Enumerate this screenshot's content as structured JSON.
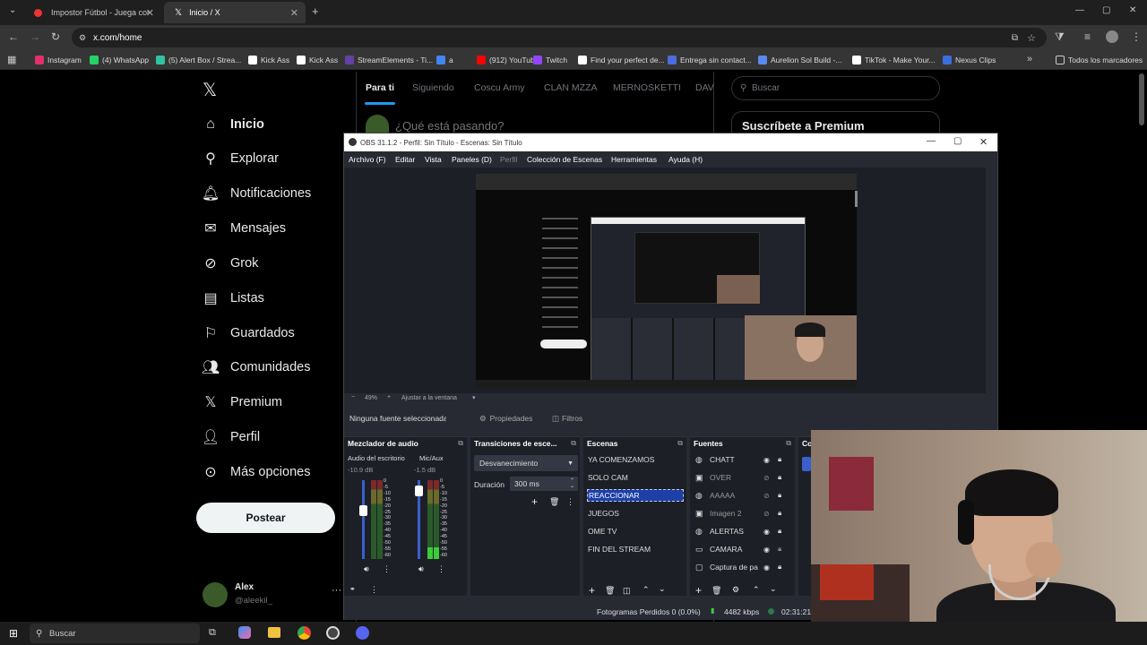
{
  "browser": {
    "tabs": [
      {
        "title": "Impostor Fútbol - Juega con ami"
      },
      {
        "title": "Inicio / X"
      }
    ],
    "url": "x.com/home",
    "bookmarks": [
      {
        "label": "Instagram",
        "color": "#e1306c"
      },
      {
        "label": "(4) WhatsApp",
        "color": "#25d366"
      },
      {
        "label": "(5) Alert Box / Strea...",
        "color": "#31c3a2"
      },
      {
        "label": "Kick Ass",
        "color": "#ffffff"
      },
      {
        "label": "Kick Ass",
        "color": "#ffffff"
      },
      {
        "label": "StreamElements - Ti...",
        "color": "#6441a5"
      },
      {
        "label": "a",
        "color": "#4285f4"
      },
      {
        "label": "(912) YouTube",
        "color": "#ff0000"
      },
      {
        "label": "Twitch",
        "color": "#9146ff"
      },
      {
        "label": "Find your perfect de...",
        "color": "#ffffff"
      },
      {
        "label": "Entrega sin contact...",
        "color": "#4a6ee0"
      },
      {
        "label": "Aurelion Sol Build -...",
        "color": "#5a8af0"
      },
      {
        "label": "TikTok - Make Your...",
        "color": "#ffffff"
      },
      {
        "label": "Nexus Clips",
        "color": "#3b6fe0"
      }
    ],
    "bookmarks_folder": "Todos los marcadores"
  },
  "x": {
    "nav": [
      {
        "label": "Inicio",
        "icon": "home-icon",
        "glyph": "⌂",
        "bold": true
      },
      {
        "label": "Explorar",
        "icon": "search-icon",
        "glyph": "⚲"
      },
      {
        "label": "Notificaciones",
        "icon": "bell-icon",
        "glyph": "🔔︎"
      },
      {
        "label": "Mensajes",
        "icon": "mail-icon",
        "glyph": "✉"
      },
      {
        "label": "Grok",
        "icon": "grok-icon",
        "glyph": "⊘"
      },
      {
        "label": "Listas",
        "icon": "list-icon",
        "glyph": "▤"
      },
      {
        "label": "Guardados",
        "icon": "bookmark-icon",
        "glyph": "⚐"
      },
      {
        "label": "Comunidades",
        "icon": "people-icon",
        "glyph": "👥︎"
      },
      {
        "label": "Premium",
        "icon": "x-logo-icon",
        "glyph": "𝕏"
      },
      {
        "label": "Perfil",
        "icon": "person-icon",
        "glyph": "👤︎"
      },
      {
        "label": "Más opciones",
        "icon": "more-circle-icon",
        "glyph": "⊙"
      }
    ],
    "post_button": "Postear",
    "user": {
      "name": "Alex",
      "handle": "@aleekil_"
    },
    "feed_tabs": [
      "Para ti",
      "Siguiendo",
      "Coscu Army",
      "CLAN MZZA",
      "MERNOSKETTI",
      "DAV"
    ],
    "compose_placeholder": "¿Qué está pasando?",
    "search_placeholder": "Buscar",
    "premium_title": "Suscríbete a Premium"
  },
  "obs": {
    "title": "OBS 31.1.2 - Perfil: Sin Título - Escenas: Sin Título",
    "menu": [
      "Archivo (F)",
      "Editar",
      "Vista",
      "Paneles (D)",
      "Perfil",
      "Colección de Escenas",
      "Herramientas",
      "Ayuda (H)"
    ],
    "zoom": "49%",
    "fit_label": "Ajustar a la ventana",
    "no_source": "Ninguna fuente seleccionada",
    "properties": "Propiedades",
    "filters": "Filtros",
    "mixer": {
      "title": "Mezclador de audio",
      "ch1": "Audio del escritorio",
      "ch1_db": "-10.9 dB",
      "ch2": "Mic/Aux",
      "ch2_db": "-1.5 dB",
      "scale": [
        "0",
        "-5",
        "-10",
        "-15",
        "-20",
        "-25",
        "-30",
        "-35",
        "-40",
        "-45",
        "-50",
        "-55",
        "-60"
      ]
    },
    "transitions": {
      "title": "Transiciones de esce...",
      "type": "Desvanecimiento",
      "duration_label": "Duración",
      "duration": "300 ms"
    },
    "scenes": {
      "title": "Escenas",
      "items": [
        "YA COMENZAMOS",
        "SOLO CAM",
        "REACCIONAR",
        "JUEGOS",
        "OME TV",
        "FIN DEL STREAM"
      ],
      "selected": "REACCIONAR"
    },
    "sources": {
      "title": "Fuentes",
      "items": [
        {
          "name": "CHATT",
          "icon": "browser-source-icon",
          "glyph": "◍",
          "visible": true,
          "locked": true
        },
        {
          "name": "OVER",
          "icon": "image-source-icon",
          "glyph": "▣",
          "visible": false,
          "locked": true
        },
        {
          "name": "AAAAA",
          "icon": "browser-source-icon",
          "glyph": "◍",
          "visible": false,
          "locked": true
        },
        {
          "name": "Imagen 2",
          "icon": "image-source-icon",
          "glyph": "▣",
          "visible": false,
          "locked": true
        },
        {
          "name": "ALERTAS",
          "icon": "browser-source-icon",
          "glyph": "◍",
          "visible": true,
          "locked": true
        },
        {
          "name": "CAMARA",
          "icon": "camera-source-icon",
          "glyph": "▭",
          "visible": true,
          "locked": false
        },
        {
          "name": "Captura de pa",
          "icon": "display-source-icon",
          "glyph": "▢",
          "visible": true,
          "locked": true
        }
      ]
    },
    "controls_short": "Co",
    "status": {
      "dropped": "Fotogramas Perdidos 0 (0.0%)",
      "kbps": "4482 kbps",
      "time": "02:31:21"
    }
  },
  "taskbar": {
    "search": "Buscar"
  }
}
